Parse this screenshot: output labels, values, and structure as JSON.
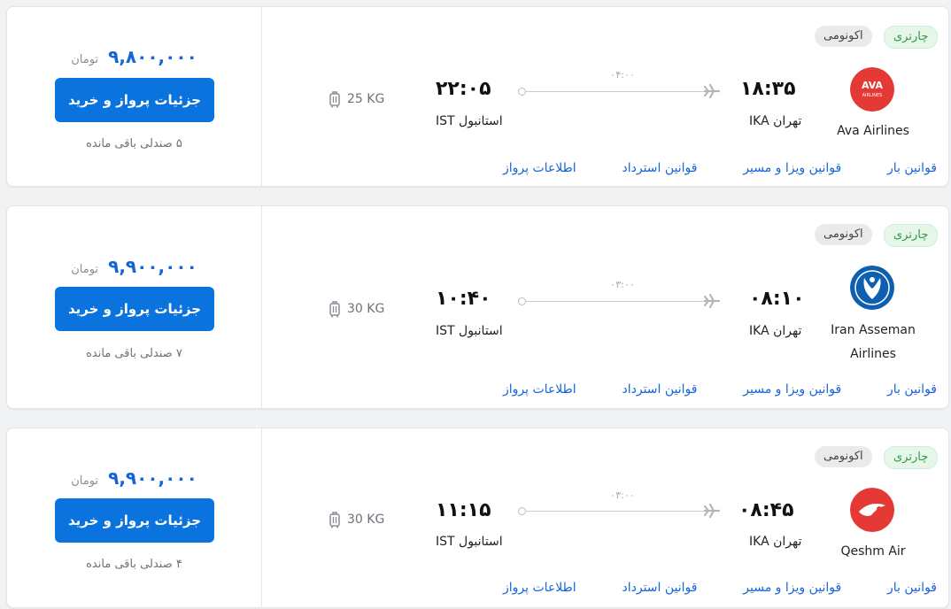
{
  "flights": [
    {
      "airline": "Ava Airlines",
      "charter_label": "چارتری",
      "class_label": "اکونومی",
      "dep_time": "۱۸:۳۵",
      "dep_city": "تهران IKA",
      "arr_time": "۲۲:۰۵",
      "arr_city": "استانبول IST",
      "duration": "۰۴:۰۰",
      "baggage": "25 KG",
      "price": "۹,۸۰۰,۰۰۰",
      "currency": "تومان",
      "buy_label": "جزئیات پرواز و خرید",
      "seats": "۵ صندلی باقی مانده",
      "links": [
        "اطلاعات پرواز",
        "قوانین استرداد",
        "قوانین ویزا و مسیر",
        "قوانین بار"
      ],
      "logo_color": "#e53935",
      "logo_text": "AVA AIRLINES"
    },
    {
      "airline": "Iran Asseman Airlines",
      "charter_label": "چارتری",
      "class_label": "اکونومی",
      "dep_time": "۰۸:۱۰",
      "dep_city": "تهران IKA",
      "arr_time": "۱۰:۴۰",
      "arr_city": "استانبول IST",
      "duration": "۰۳:۰۰",
      "baggage": "30 KG",
      "price": "۹,۹۰۰,۰۰۰",
      "currency": "تومان",
      "buy_label": "جزئیات پرواز و خرید",
      "seats": "۷ صندلی باقی مانده",
      "links": [
        "اطلاعات پرواز",
        "قوانین استرداد",
        "قوانین ویزا و مسیر",
        "قوانین بار"
      ],
      "logo_color": "#0d5fb0"
    },
    {
      "airline": "Qeshm Air",
      "charter_label": "چارتری",
      "class_label": "اکونومی",
      "dep_time": "۰۸:۴۵",
      "dep_city": "تهران IKA",
      "arr_time": "۱۱:۱۵",
      "arr_city": "استانبول IST",
      "duration": "۰۳:۰۰",
      "baggage": "30 KG",
      "price": "۹,۹۰۰,۰۰۰",
      "currency": "تومان",
      "buy_label": "جزئیات پرواز و خرید",
      "seats": "۴ صندلی باقی مانده",
      "links": [
        "اطلاعات پرواز",
        "قوانین استرداد",
        "قوانین ویزا و مسیر",
        "قوانین بار"
      ],
      "logo_color": "#e53935"
    }
  ],
  "colors": {
    "accent": "#0a73dd",
    "price": "#1565d8",
    "charter_bg": "#e6f7ea",
    "charter_text": "#2a9a47"
  }
}
